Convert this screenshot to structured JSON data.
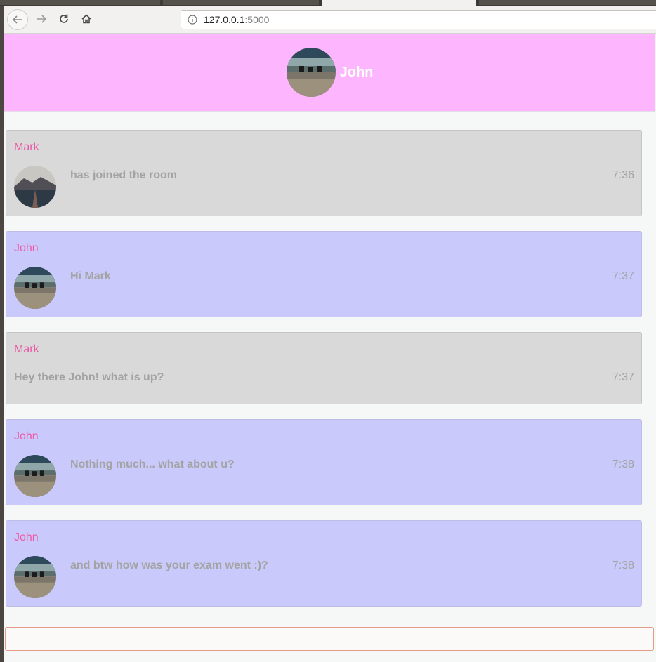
{
  "browser": {
    "url_host": "127.0.0.1",
    "url_port": ":5000"
  },
  "header": {
    "name": "John"
  },
  "messages": [
    {
      "sender": "Mark",
      "text": "has joined the room",
      "time": "7:36"
    },
    {
      "sender": "John",
      "text": "Hi Mark",
      "time": "7:37"
    },
    {
      "sender": "Mark",
      "text": "Hey there John! what is up?",
      "time": "7:37"
    },
    {
      "sender": "John",
      "text": "Nothing much... what about u?",
      "time": "7:38"
    },
    {
      "sender": "John",
      "text": "and btw how was your exam went :)?",
      "time": "7:38"
    }
  ],
  "input": {
    "value": ""
  },
  "colors": {
    "header_bg": "#fdb5fd",
    "self_bubble": "#c9c9fb",
    "other_bubble": "#d9d9d9",
    "sender_name": "#ec5aa6",
    "message_text": "#a3a3a3",
    "input_border": "#e39a86"
  },
  "icons": {
    "back": "arrow-left-icon",
    "forward": "arrow-right-icon",
    "reload": "reload-icon",
    "home": "home-icon",
    "site_info": "info-icon"
  }
}
